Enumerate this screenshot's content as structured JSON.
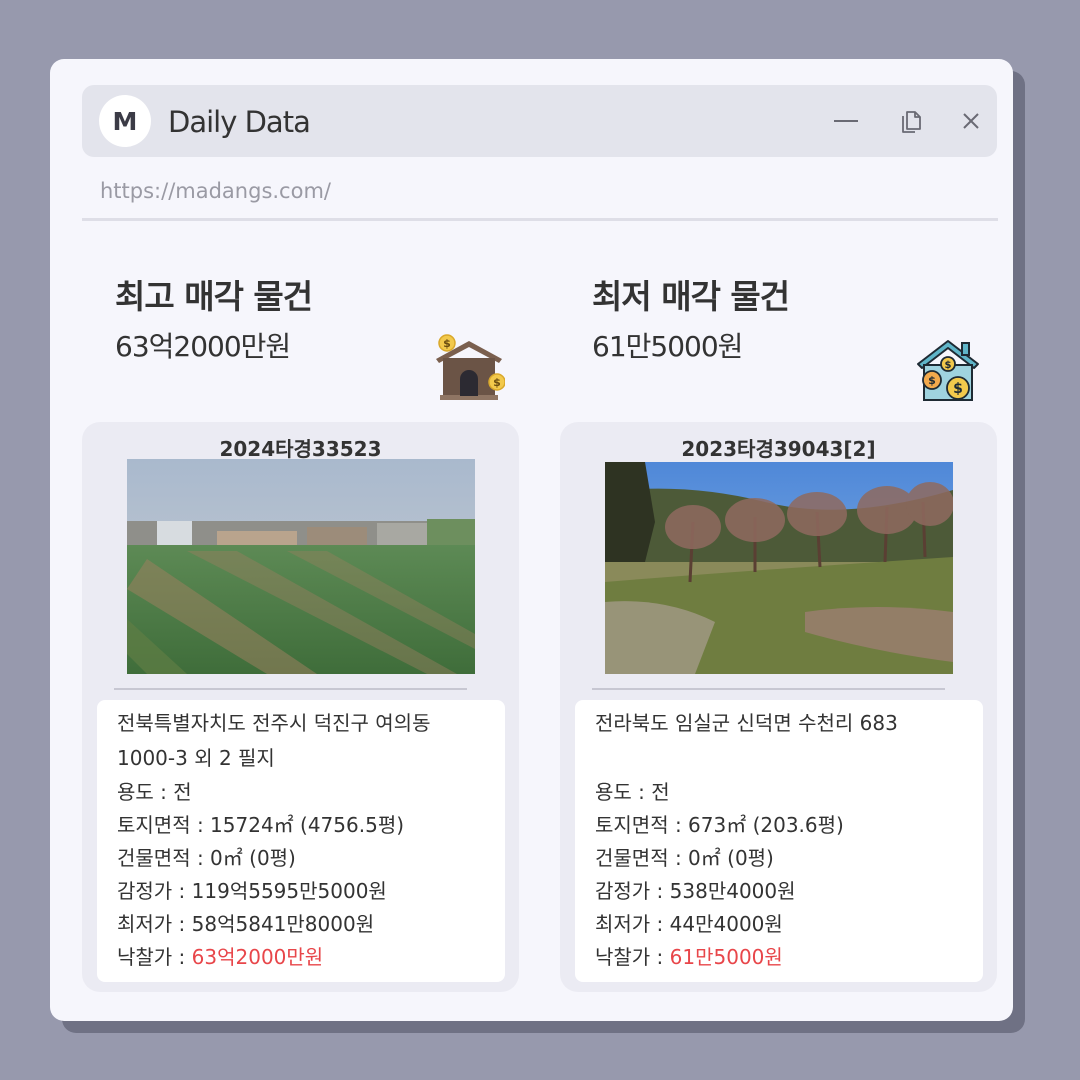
{
  "window": {
    "logo_letter": "M",
    "title": "Daily Data",
    "url": "https://madangs.com/",
    "minimize_icon": "minimize-icon",
    "copy_icon": "copy-icon",
    "close_icon": "close-icon"
  },
  "highest": {
    "title": "최고 매각 물건",
    "price": "63억2000만원",
    "icon": "house-money-icon",
    "card": {
      "case_no": "2024타경33523",
      "address_line1": "전북특별자치도 전주시 덕진구 여의동",
      "address_line2": "1000-3 외 2 필지",
      "usage": "용도 : 전",
      "land_area": "토지면적 : 15724㎡ (4756.5평)",
      "building_area": "건물면적 : 0㎡ (0평)",
      "appraisal": "감정가 : 119억5595만5000원",
      "minimum": "최저가 : 58억5841만8000원",
      "winning_label": "낙찰가 : ",
      "winning_value": "63억2000만원"
    }
  },
  "lowest": {
    "title": "최저 매각 물건",
    "price": "61만5000원",
    "icon": "house-coins-icon",
    "card": {
      "case_no": "2023타경39043[2]",
      "address_line1": "전라북도 임실군 신덕면 수천리 683",
      "address_line2": "",
      "usage": "용도 :  전",
      "land_area": "토지면적 : 673㎡ (203.6평)",
      "building_area": "건물면적 : 0㎡ (0평)",
      "appraisal": "감정가 : 538만4000원",
      "minimum": "최저가 : 44만4000원",
      "winning_label": "낙찰가 : ",
      "winning_value": "61만5000원"
    }
  },
  "colors": {
    "background": "#9799ad",
    "window": "#f6f6fc",
    "card": "#ebebf3",
    "accent_red": "#e8464a"
  }
}
